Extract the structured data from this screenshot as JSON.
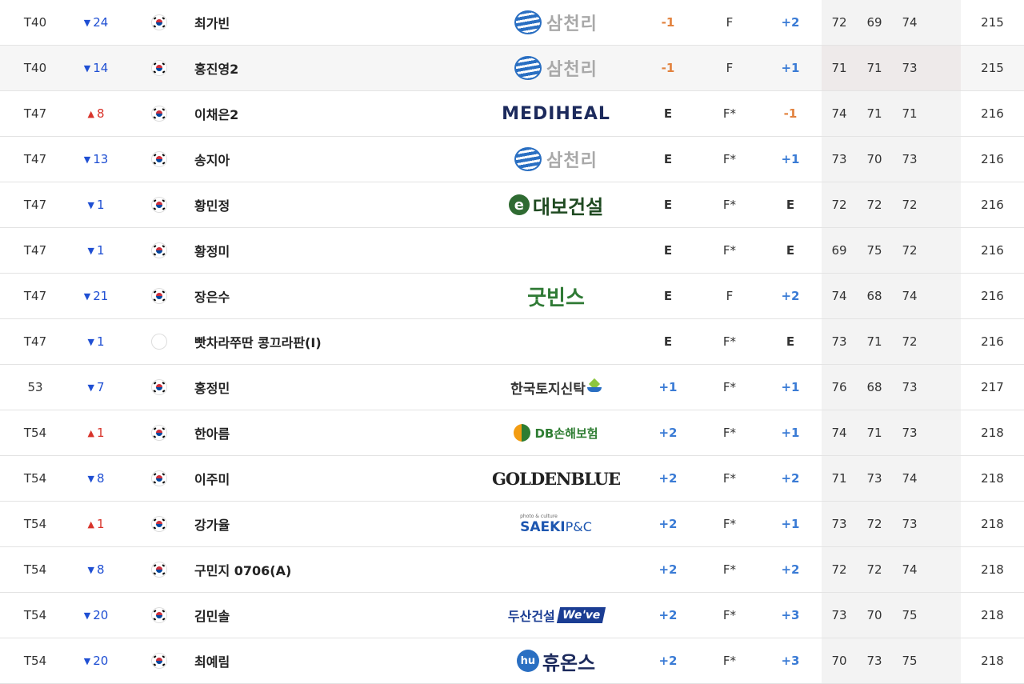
{
  "rows": [
    {
      "rank": "T40",
      "move_dir": "down",
      "move": "24",
      "flag": "kr",
      "name": "최가빈",
      "sponsor": "samchully",
      "score": "-1",
      "score_color": "orange",
      "thru": "F",
      "today": "+2",
      "today_color": "blue",
      "r1": "72",
      "r2": "69",
      "r3": "74",
      "total": "215",
      "hover": false
    },
    {
      "rank": "T40",
      "move_dir": "down",
      "move": "14",
      "flag": "kr",
      "name": "홍진영2",
      "sponsor": "samchully",
      "score": "-1",
      "score_color": "orange",
      "thru": "F",
      "today": "+1",
      "today_color": "blue",
      "r1": "71",
      "r2": "71",
      "r3": "73",
      "total": "215",
      "hover": true
    },
    {
      "rank": "T47",
      "move_dir": "up",
      "move": "8",
      "flag": "kr",
      "name": "이채은2",
      "sponsor": "mediheal",
      "score": "E",
      "score_color": "dark",
      "thru": "F*",
      "today": "-1",
      "today_color": "orange",
      "r1": "74",
      "r2": "71",
      "r3": "71",
      "total": "216",
      "hover": false
    },
    {
      "rank": "T47",
      "move_dir": "down",
      "move": "13",
      "flag": "kr",
      "name": "송지아",
      "sponsor": "samchully",
      "score": "E",
      "score_color": "dark",
      "thru": "F*",
      "today": "+1",
      "today_color": "blue",
      "r1": "73",
      "r2": "70",
      "r3": "73",
      "total": "216",
      "hover": false
    },
    {
      "rank": "T47",
      "move_dir": "down",
      "move": "1",
      "flag": "kr",
      "name": "황민정",
      "sponsor": "daebo",
      "score": "E",
      "score_color": "dark",
      "thru": "F*",
      "today": "E",
      "today_color": "dark",
      "r1": "72",
      "r2": "72",
      "r3": "72",
      "total": "216",
      "hover": false
    },
    {
      "rank": "T47",
      "move_dir": "down",
      "move": "1",
      "flag": "kr",
      "name": "황정미",
      "sponsor": "",
      "score": "E",
      "score_color": "dark",
      "thru": "F*",
      "today": "E",
      "today_color": "dark",
      "r1": "69",
      "r2": "75",
      "r3": "72",
      "total": "216",
      "hover": false
    },
    {
      "rank": "T47",
      "move_dir": "down",
      "move": "21",
      "flag": "kr",
      "name": "장은수",
      "sponsor": "goodbins",
      "score": "E",
      "score_color": "dark",
      "thru": "F",
      "today": "+2",
      "today_color": "blue",
      "r1": "74",
      "r2": "68",
      "r3": "74",
      "total": "216",
      "hover": false
    },
    {
      "rank": "T47",
      "move_dir": "down",
      "move": "1",
      "flag": "th",
      "name": "빳차라쭈딴 콩끄라판(I)",
      "sponsor": "",
      "score": "E",
      "score_color": "dark",
      "thru": "F*",
      "today": "E",
      "today_color": "dark",
      "r1": "73",
      "r2": "71",
      "r3": "72",
      "total": "216",
      "hover": false
    },
    {
      "rank": "53",
      "move_dir": "down",
      "move": "7",
      "flag": "kr",
      "name": "홍정민",
      "sponsor": "ktrust",
      "score": "+1",
      "score_color": "blue",
      "thru": "F*",
      "today": "+1",
      "today_color": "blue",
      "r1": "76",
      "r2": "68",
      "r3": "73",
      "total": "217",
      "hover": false
    },
    {
      "rank": "T54",
      "move_dir": "up",
      "move": "1",
      "flag": "kr",
      "name": "한아름",
      "sponsor": "db",
      "score": "+2",
      "score_color": "blue",
      "thru": "F*",
      "today": "+1",
      "today_color": "blue",
      "r1": "74",
      "r2": "71",
      "r3": "73",
      "total": "218",
      "hover": false
    },
    {
      "rank": "T54",
      "move_dir": "down",
      "move": "8",
      "flag": "kr",
      "name": "이주미",
      "sponsor": "golden",
      "score": "+2",
      "score_color": "blue",
      "thru": "F*",
      "today": "+2",
      "today_color": "blue",
      "r1": "71",
      "r2": "73",
      "r3": "74",
      "total": "218",
      "hover": false
    },
    {
      "rank": "T54",
      "move_dir": "up",
      "move": "1",
      "flag": "kr",
      "name": "강가율",
      "sponsor": "saeki",
      "score": "+2",
      "score_color": "blue",
      "thru": "F*",
      "today": "+1",
      "today_color": "blue",
      "r1": "73",
      "r2": "72",
      "r3": "73",
      "total": "218",
      "hover": false
    },
    {
      "rank": "T54",
      "move_dir": "down",
      "move": "8",
      "flag": "kr",
      "name": "구민지 0706(A)",
      "sponsor": "",
      "score": "+2",
      "score_color": "blue",
      "thru": "F*",
      "today": "+2",
      "today_color": "blue",
      "r1": "72",
      "r2": "72",
      "r3": "74",
      "total": "218",
      "hover": false
    },
    {
      "rank": "T54",
      "move_dir": "down",
      "move": "20",
      "flag": "kr",
      "name": "김민솔",
      "sponsor": "doosan",
      "score": "+2",
      "score_color": "blue",
      "thru": "F*",
      "today": "+3",
      "today_color": "blue",
      "r1": "73",
      "r2": "70",
      "r3": "75",
      "total": "218",
      "hover": false
    },
    {
      "rank": "T54",
      "move_dir": "down",
      "move": "20",
      "flag": "kr",
      "name": "최예림",
      "sponsor": "huons",
      "score": "+2",
      "score_color": "blue",
      "thru": "F*",
      "today": "+3",
      "today_color": "blue",
      "r1": "70",
      "r2": "73",
      "r3": "75",
      "total": "218",
      "hover": false
    }
  ],
  "sponsors": {
    "samchully": {
      "text": "삼천리"
    },
    "mediheal": {
      "text": "MEDIHEAL"
    },
    "daebo": {
      "mark": "e",
      "text": "대보건설"
    },
    "goodbins": {
      "text": "굿빈스"
    },
    "ktrust": {
      "text": "한국토지신탁"
    },
    "db": {
      "text": "DB손해보험"
    },
    "golden": {
      "text": "GOLDENBLUE"
    },
    "saeki": {
      "tiny": "photo & culture",
      "text": "SAEKI",
      "suffix": "P&C"
    },
    "doosan": {
      "text": "두산건설",
      "badge": "We've"
    },
    "huons": {
      "mark": "hu",
      "text": "휴온스"
    }
  },
  "icons": {
    "up_arrow": "▲",
    "down_arrow": "▼"
  },
  "colors": {
    "down": "#1f4fd3",
    "up": "#d8342b",
    "over_par": "#3a7bd5",
    "under_par": "#e2823e"
  }
}
